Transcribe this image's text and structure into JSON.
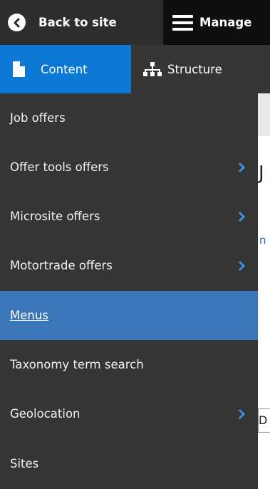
{
  "toolbar": {
    "back_label": "Back to site",
    "manage_label": "Manage"
  },
  "tabs": {
    "content_label": "Content",
    "structure_label": "Structure"
  },
  "menu": {
    "items": [
      {
        "label": "Job offers",
        "has_submenu": false,
        "active": false
      },
      {
        "label": "Offer tools offers",
        "has_submenu": true,
        "active": false
      },
      {
        "label": "Microsite offers",
        "has_submenu": true,
        "active": false
      },
      {
        "label": "Motortrade offers",
        "has_submenu": true,
        "active": false
      },
      {
        "label": "Menus",
        "has_submenu": false,
        "active": true
      },
      {
        "label": "Taxonomy term search",
        "has_submenu": false,
        "active": false
      },
      {
        "label": "Geolocation",
        "has_submenu": true,
        "active": false
      },
      {
        "label": "Sites",
        "has_submenu": false,
        "active": false
      }
    ]
  },
  "background": {
    "heading_fragment": "J",
    "link_fragment": "n",
    "field_fragment": "D"
  },
  "colors": {
    "toolbar_dark": "#0f0f0f",
    "back_bg": "#2d2d2d",
    "menu_bg": "#353535",
    "content_tab_blue": "#0b78d4",
    "active_item_blue": "#3a76b8",
    "chevron_blue": "#3d8fe0"
  }
}
